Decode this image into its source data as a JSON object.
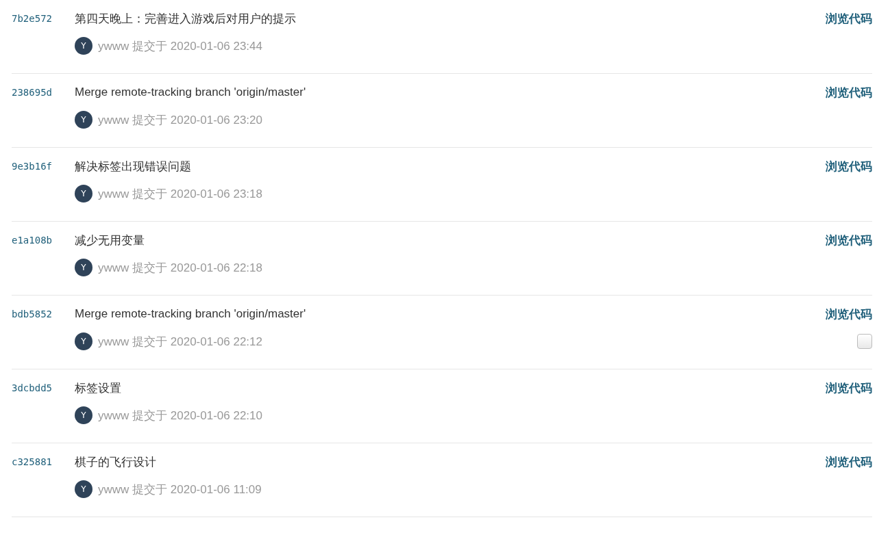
{
  "commits": [
    {
      "hash": "7b2e572",
      "message": "第四天晚上：完善进入游戏后对用户的提示",
      "avatar": "Y",
      "author": "ywww",
      "action": "提交于",
      "time": "2020-01-06 23:44",
      "browse": "浏览代码"
    },
    {
      "hash": "238695d",
      "message": "Merge remote-tracking branch 'origin/master'",
      "avatar": "Y",
      "author": "ywww",
      "action": "提交于",
      "time": "2020-01-06 23:20",
      "browse": "浏览代码"
    },
    {
      "hash": "9e3b16f",
      "message": "解决标签出现错误问题",
      "avatar": "Y",
      "author": "ywww",
      "action": "提交于",
      "time": "2020-01-06 23:18",
      "browse": "浏览代码"
    },
    {
      "hash": "e1a108b",
      "message": "减少无用变量",
      "avatar": "Y",
      "author": "ywww",
      "action": "提交于",
      "time": "2020-01-06 22:18",
      "browse": "浏览代码"
    },
    {
      "hash": "bdb5852",
      "message": "Merge remote-tracking branch 'origin/master'",
      "avatar": "Y",
      "author": "ywww",
      "action": "提交于",
      "time": "2020-01-06 22:12",
      "browse": "浏览代码",
      "checkbox": {
        "checked": false
      }
    },
    {
      "hash": "3dcbdd5",
      "message": "标签设置",
      "avatar": "Y",
      "author": "ywww",
      "action": "提交于",
      "time": "2020-01-06 22:10",
      "browse": "浏览代码"
    },
    {
      "hash": "c325881",
      "message": "棋子的飞行设计",
      "avatar": "Y",
      "author": "ywww",
      "action": "提交于",
      "time": "2020-01-06 11:09",
      "browse": "浏览代码"
    }
  ]
}
